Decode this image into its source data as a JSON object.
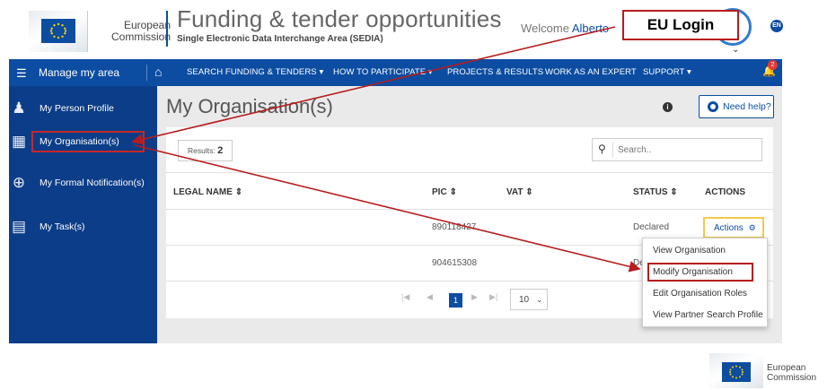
{
  "header": {
    "logo_text_line1": "European",
    "logo_text_line2": "Commission",
    "title": "Funding & tender opportunities",
    "subtitle": "Single Electronic Data Interchange Area (SEDIA)",
    "welcome_prefix": "Welcome",
    "user_name": "Alberto",
    "language_badge": "EN",
    "eu_login_label": "EU Login"
  },
  "navbar": {
    "manage_label": "Manage my area",
    "items": [
      {
        "label": "SEARCH FUNDING & TENDERS",
        "has_dropdown": true
      },
      {
        "label": "HOW TO PARTICIPATE",
        "has_dropdown": true
      },
      {
        "label": "PROJECTS & RESULTS",
        "has_dropdown": false
      },
      {
        "label": "WORK AS AN EXPERT",
        "has_dropdown": false
      },
      {
        "label": "SUPPORT",
        "has_dropdown": true
      }
    ],
    "notification_count": "2"
  },
  "sidebar": {
    "items": [
      {
        "label": "My Person Profile",
        "icon": "person-profile-icon"
      },
      {
        "label": "My Organisation(s)",
        "icon": "organisation-icon",
        "selected": true
      },
      {
        "label": "My Formal Notification(s)",
        "icon": "globe-notification-icon"
      },
      {
        "label": "My Task(s)",
        "icon": "tasks-icon"
      }
    ]
  },
  "main": {
    "page_title": "My Organisation(s)",
    "info_icon": "i",
    "help_label": "Need help?",
    "results_label": "Results:",
    "results_count": "2",
    "search_placeholder": "Search..",
    "columns": {
      "legal_name": "LEGAL NAME ⇕",
      "pic": "PIC ⇕",
      "vat": "VAT ⇕",
      "status": "STATUS ⇕",
      "actions": "ACTIONS"
    },
    "rows": [
      {
        "legal_name": "",
        "pic": "890118427",
        "vat": "",
        "status": "Declared",
        "actions_label": "Actions"
      },
      {
        "legal_name": "",
        "pic": "904615308",
        "vat": "",
        "status": "De",
        "actions_label": ""
      }
    ],
    "pager": {
      "first": "|◀",
      "prev": "◀",
      "current_page": "1",
      "next": "▶",
      "last": "▶|",
      "page_size": "10"
    }
  },
  "actions_menu": {
    "items": [
      "View Organisation",
      "Modify Organisation",
      "Edit Organisation Roles",
      "View Partner Search Profile"
    ],
    "highlighted": "Modify Organisation"
  },
  "footer_logo": {
    "line1": "European",
    "line2": "Commission"
  },
  "colors": {
    "brand_blue": "#0c4da2",
    "sidebar_blue": "#0c3d88",
    "annotation_red": "#b71c1c",
    "actions_border": "#f2c94c"
  }
}
